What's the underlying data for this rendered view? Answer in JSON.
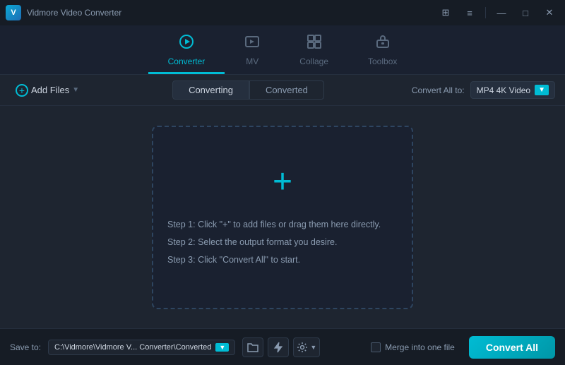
{
  "app": {
    "logo_text": "V",
    "title": "Vidmore Video Converter"
  },
  "titlebar": {
    "tiles_btn": "⊞",
    "minimize_btn": "—",
    "maximize_btn": "□",
    "close_btn": "✕",
    "menu_btn": "≡"
  },
  "nav": {
    "tabs": [
      {
        "id": "converter",
        "label": "Converter",
        "icon": "⊙",
        "active": true
      },
      {
        "id": "mv",
        "label": "MV",
        "icon": "🖼",
        "active": false
      },
      {
        "id": "collage",
        "label": "Collage",
        "icon": "⊞",
        "active": false
      },
      {
        "id": "toolbox",
        "label": "Toolbox",
        "icon": "🧰",
        "active": false
      }
    ]
  },
  "toolbar": {
    "add_files_label": "Add Files",
    "converting_label": "Converting",
    "converted_label": "Converted",
    "convert_all_to_label": "Convert All to:",
    "format_value": "MP4 4K Video"
  },
  "drop_zone": {
    "plus_icon": "+",
    "step1": "Step 1: Click \"+\" to add files or drag them here directly.",
    "step2": "Step 2: Select the output format you desire.",
    "step3": "Step 3: Click \"Convert All\" to start."
  },
  "bottom_bar": {
    "save_to_label": "Save to:",
    "save_path": "C:\\Vidmore\\Vidmore V... Converter\\Converted",
    "merge_label": "Merge into one file",
    "convert_all_label": "Convert All"
  }
}
